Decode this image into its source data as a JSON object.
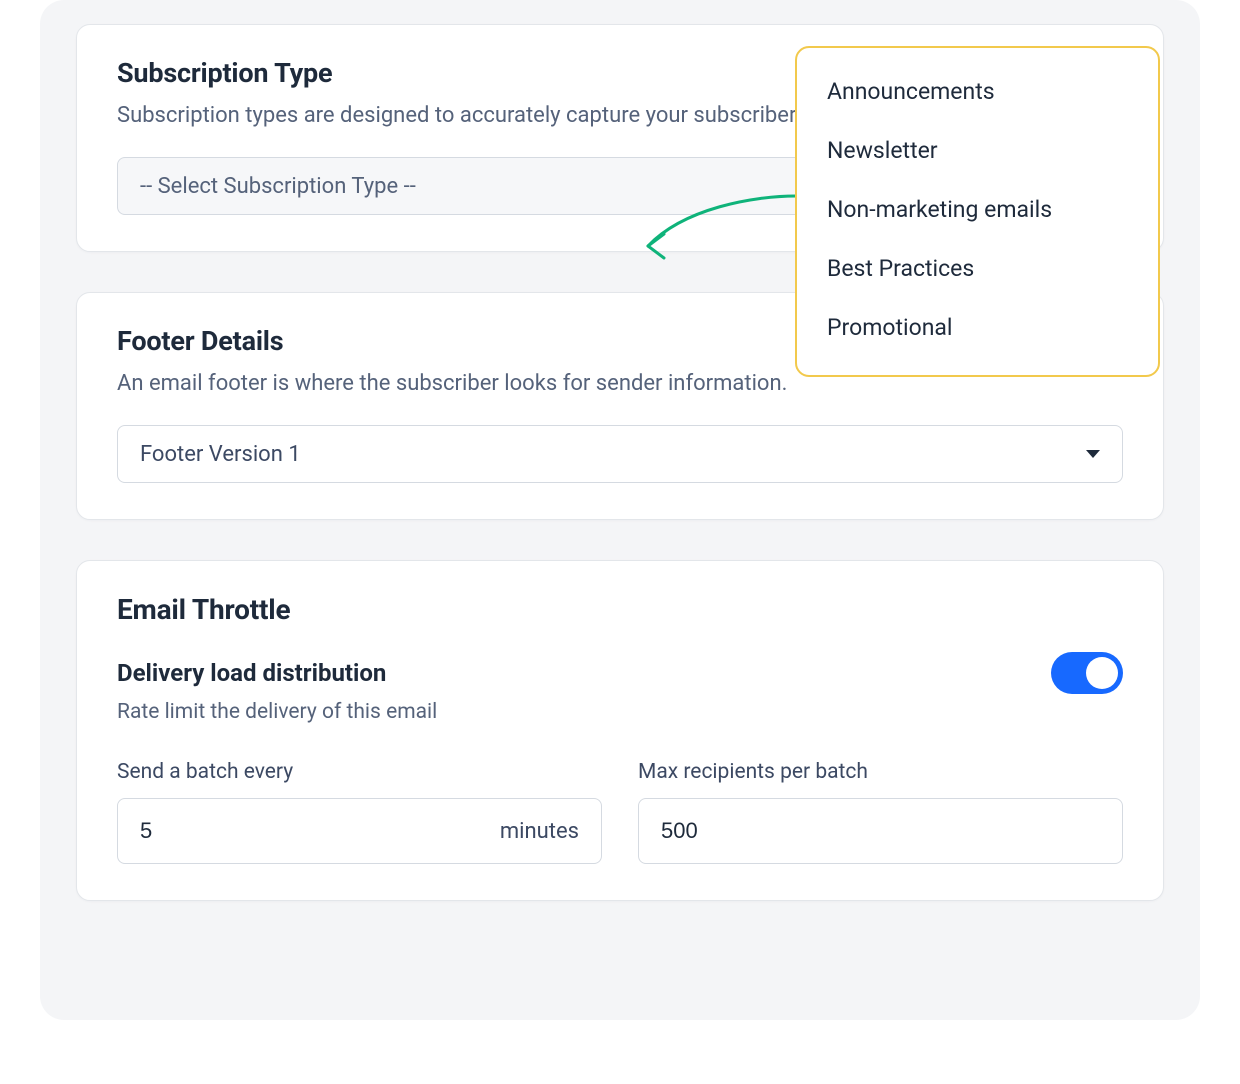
{
  "subscription": {
    "title": "Subscription Type",
    "desc": "Subscription types are designed to accurately capture your subscriber's subscription preferences.",
    "placeholder": "-- Select Subscription Type --",
    "options": [
      "Announcements",
      "Newsletter",
      "Non-marketing emails",
      "Best Practices",
      "Promotional"
    ]
  },
  "footer": {
    "title": "Footer Details",
    "desc": "An email footer is where the subscriber looks for sender information.",
    "selected": "Footer Version 1"
  },
  "throttle": {
    "title": "Email Throttle",
    "sub_title": "Delivery load distribution",
    "sub_desc": "Rate limit the delivery of this email",
    "toggle_on": true,
    "batch_every_label": "Send a batch every",
    "batch_every_value": "5",
    "batch_every_unit": "minutes",
    "max_recipients_label": "Max recipients per batch",
    "max_recipients_value": "500"
  }
}
